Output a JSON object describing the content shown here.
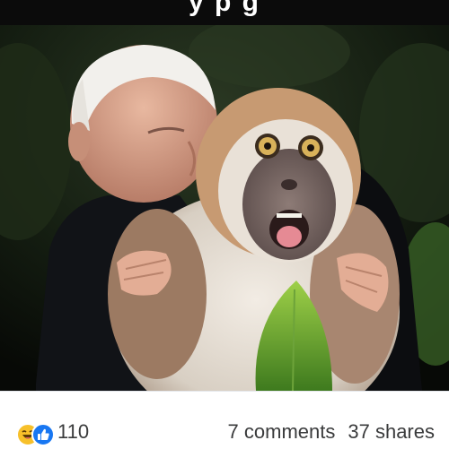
{
  "caption": {
    "text": "y p g"
  },
  "reactions": {
    "icons": [
      "haha-icon",
      "like-icon"
    ],
    "count": "110",
    "haha_color": "#f7c02a",
    "like_color": "#1877f2"
  },
  "counts": {
    "comments": "7 comments",
    "shares": "37 shares"
  }
}
